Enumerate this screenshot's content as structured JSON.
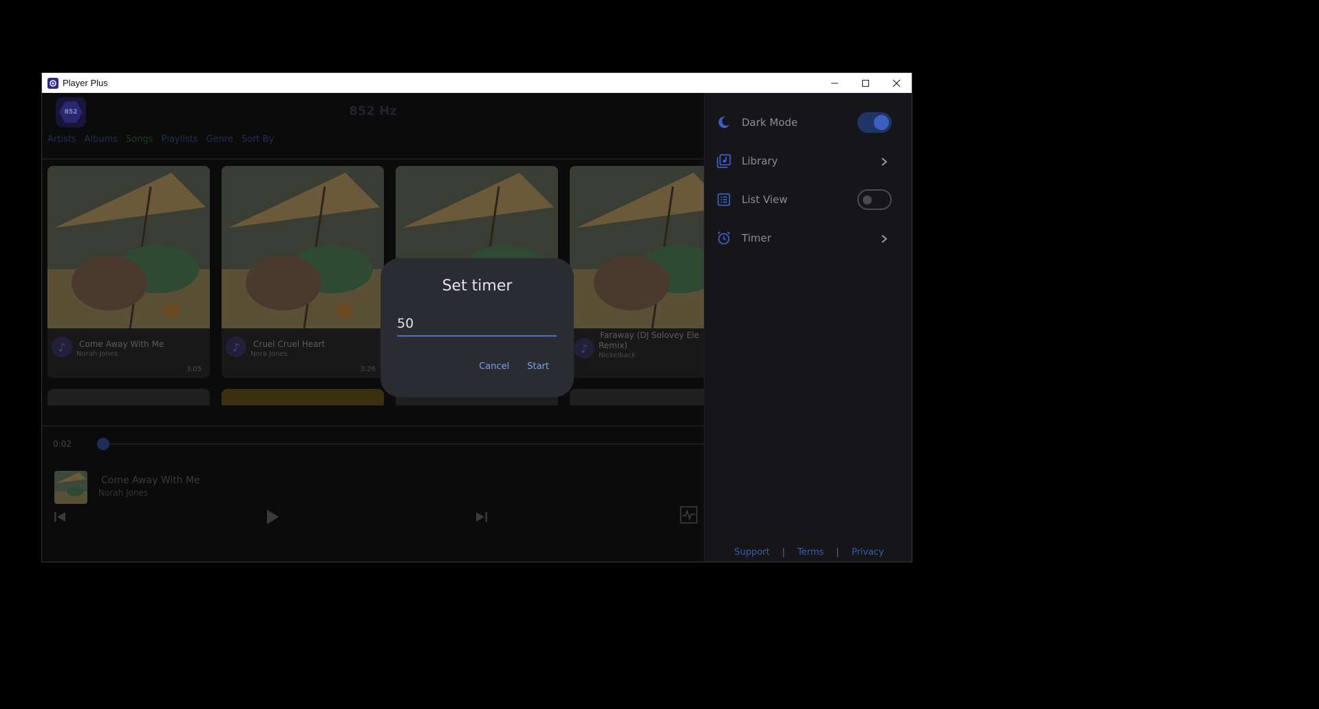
{
  "window": {
    "title": "Player Plus"
  },
  "app": {
    "logo_text": "852",
    "frequency_title": "852 Hz",
    "nav": [
      "Artists",
      "Albums",
      "Songs",
      "Playlists",
      "Genre",
      "Sort By"
    ],
    "active_nav": "Songs"
  },
  "songs": [
    {
      "title": "Come Away With Me",
      "artist": "Norah Jones",
      "duration": "3:05"
    },
    {
      "title": "Cruel Cruel Heart",
      "artist": "Nora Jones",
      "duration": "3:26"
    },
    {
      "title": "",
      "artist": "",
      "duration": ""
    },
    {
      "title": "Faraway (DJ Solovey Ele",
      "title_line2": "Remix)",
      "artist": "Nickelback",
      "duration": ""
    }
  ],
  "player": {
    "current_time": "0:02",
    "now_title": "Come Away With Me",
    "now_artist": "Norah Jones"
  },
  "drawer": {
    "dark_mode_label": "Dark Mode",
    "dark_mode_on": true,
    "library_label": "Library",
    "list_view_label": "List View",
    "list_view_on": false,
    "timer_label": "Timer",
    "footer": {
      "support": "Support",
      "terms": "Terms",
      "privacy": "Privacy",
      "separator": "|"
    }
  },
  "dialog": {
    "title": "Set timer",
    "value": "50",
    "cancel_label": "Cancel",
    "start_label": "Start"
  },
  "colors": {
    "accent": "#3b5fbf",
    "dialog_bg": "#2b2c31",
    "link": "#7aa2ee"
  },
  "icons": [
    "app-logo-icon",
    "minimize-icon",
    "maximize-icon",
    "close-icon",
    "music-note-icon",
    "previous-icon",
    "play-icon",
    "next-icon",
    "equalizer-icon",
    "moon-icon",
    "library-icon",
    "list-icon",
    "alarm-icon",
    "chevron-right-icon"
  ]
}
